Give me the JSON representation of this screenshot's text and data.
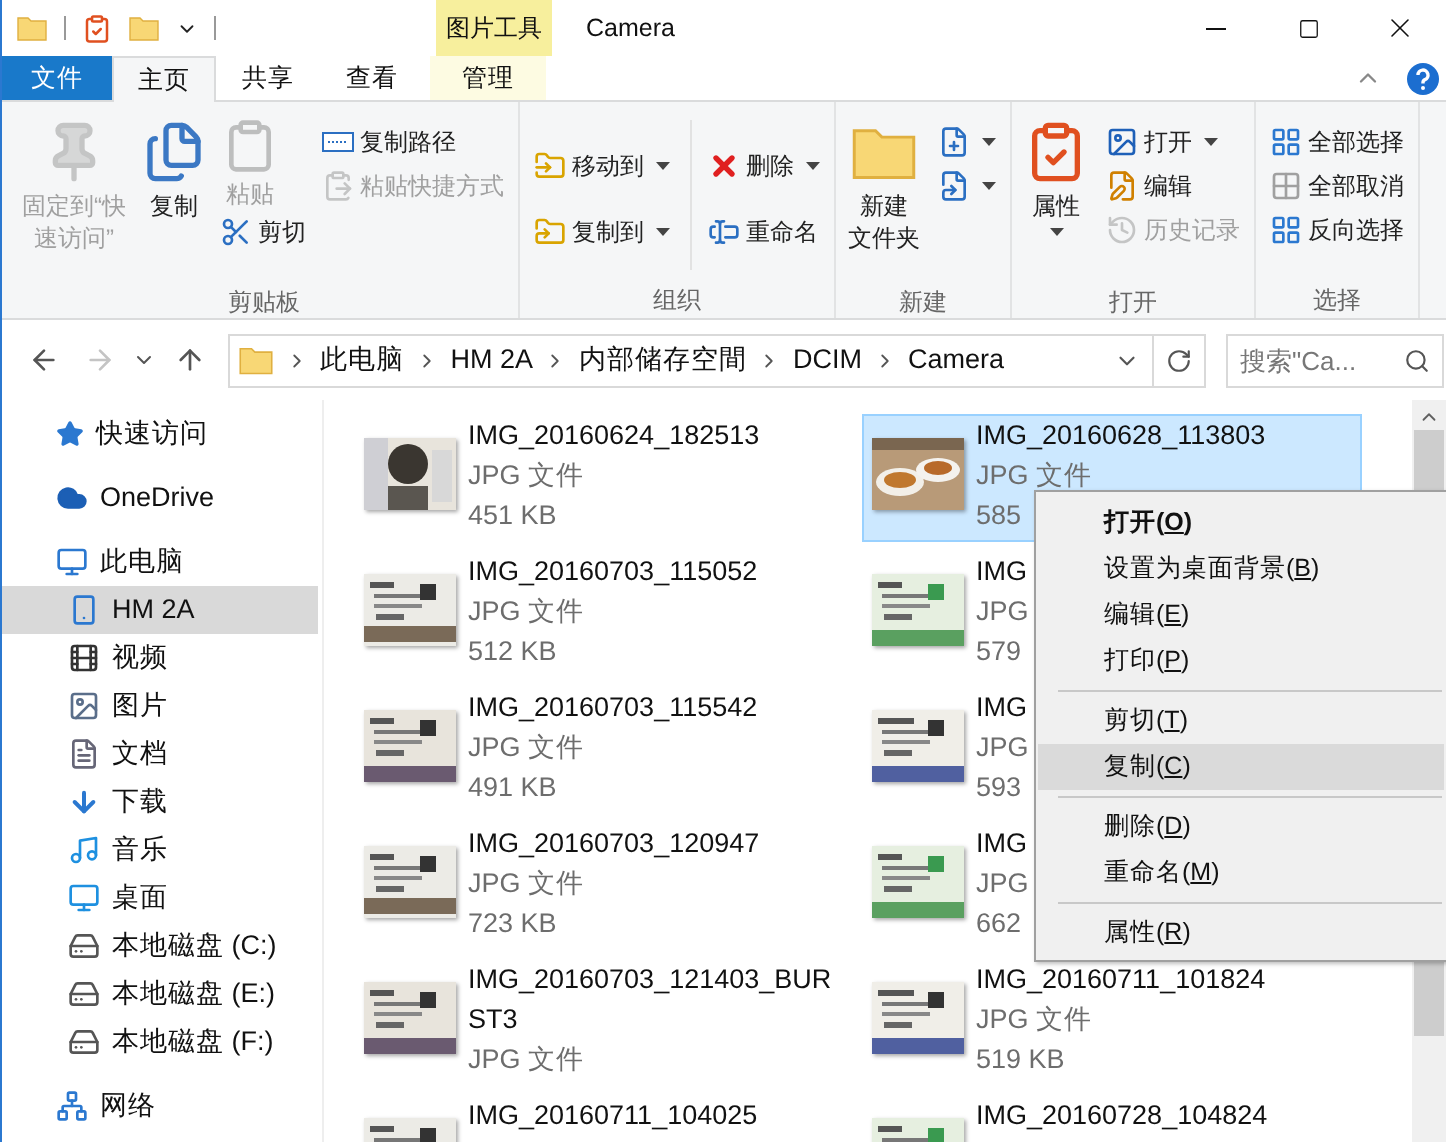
{
  "window": {
    "title": "Camera",
    "context_header": "图片工具"
  },
  "tabs": [
    {
      "label": "文件",
      "kind": "file",
      "selected": false
    },
    {
      "label": "主页",
      "kind": "tab",
      "selected": true
    },
    {
      "label": "共享",
      "kind": "tab",
      "selected": false
    },
    {
      "label": "查看",
      "kind": "tab",
      "selected": false
    },
    {
      "label": "管理",
      "kind": "context",
      "selected": false
    }
  ],
  "ribbon": {
    "groups": [
      {
        "label": "剪贴板",
        "columns": [
          {
            "kind": "large",
            "items": [
              {
                "lines": [
                  "固定到“快",
                  "速访问”"
                ],
                "disabled": true,
                "dropdown": false
              }
            ]
          },
          {
            "kind": "large",
            "items": [
              {
                "lines": [
                  "复制"
                ],
                "disabled": false,
                "dropdown": false
              }
            ]
          },
          {
            "kind": "medium",
            "items": [
              {
                "label": "粘贴",
                "disabled": true,
                "dropdown": false
              },
              {
                "label": "剪切",
                "disabled": false,
                "dropdown": false
              }
            ]
          },
          {
            "kind": "small",
            "items": [
              {
                "label": "复制路径",
                "disabled": false,
                "dropdown": false
              },
              {
                "label": "粘贴快捷方式",
                "disabled": true,
                "dropdown": false
              }
            ]
          }
        ]
      },
      {
        "label": "组织",
        "columns": [
          {
            "kind": "small",
            "items": [
              {
                "label": "移动到",
                "disabled": false,
                "dropdown": true
              },
              {
                "label": "复制到",
                "disabled": false,
                "dropdown": true
              }
            ]
          },
          {
            "kind": "small",
            "items": [
              {
                "label": "删除",
                "disabled": false,
                "dropdown": true
              },
              {
                "label": "重命名",
                "disabled": false,
                "dropdown": false
              }
            ]
          }
        ]
      },
      {
        "label": "新建",
        "columns": [
          {
            "kind": "large",
            "items": [
              {
                "lines": [
                  "新建",
                  "文件夹"
                ],
                "disabled": false,
                "dropdown": false
              }
            ]
          },
          {
            "kind": "small",
            "items": [
              {
                "disabled": false,
                "dropdown": true
              },
              {
                "disabled": false,
                "dropdown": true
              }
            ]
          }
        ]
      },
      {
        "label": "打开",
        "columns": [
          {
            "kind": "large",
            "items": [
              {
                "lines": [
                  "属性"
                ],
                "disabled": false,
                "dropdown": true
              }
            ]
          },
          {
            "kind": "small",
            "items": [
              {
                "label": "打开",
                "disabled": false,
                "dropdown": true
              },
              {
                "label": "编辑",
                "disabled": false,
                "dropdown": false
              },
              {
                "label": "历史记录",
                "disabled": true,
                "dropdown": false
              }
            ]
          }
        ]
      },
      {
        "label": "选择",
        "columns": [
          {
            "kind": "small",
            "items": [
              {
                "label": "全部选择",
                "disabled": false,
                "dropdown": false
              },
              {
                "label": "全部取消",
                "disabled": false,
                "dropdown": false
              },
              {
                "label": "反向选择",
                "disabled": false,
                "dropdown": false
              }
            ]
          }
        ]
      }
    ]
  },
  "address": {
    "buttons": [
      {
        "kind": "back",
        "disabled": false
      },
      {
        "kind": "forward",
        "disabled": true
      },
      {
        "kind": "recent",
        "disabled": false
      },
      {
        "kind": "up",
        "disabled": false
      }
    ],
    "path": [
      "此电脑",
      "HM 2A",
      "内部储存空間",
      "DCIM",
      "Camera"
    ],
    "search": {
      "placeholder": "搜索\"Ca..."
    }
  },
  "nav": [
    {
      "label": "快速访问",
      "kind": "quick",
      "selected": false
    },
    {
      "label": "OneDrive",
      "kind": "cloud",
      "selected": false
    },
    {
      "label": "此电脑",
      "kind": "pc",
      "selected": false,
      "children": [
        {
          "label": "HM 2A",
          "kind": "phone",
          "selected": true
        },
        {
          "label": "视频",
          "kind": "video",
          "selected": false
        },
        {
          "label": "图片",
          "kind": "pictures",
          "selected": false
        },
        {
          "label": "文档",
          "kind": "documents",
          "selected": false
        },
        {
          "label": "下载",
          "kind": "downloads",
          "selected": false
        },
        {
          "label": "音乐",
          "kind": "music",
          "selected": false
        },
        {
          "label": "桌面",
          "kind": "desktop",
          "selected": false
        },
        {
          "label": "本地磁盘 (C:)",
          "kind": "system-drive",
          "selected": false
        },
        {
          "label": "本地磁盘 (E:)",
          "kind": "drive",
          "selected": false
        },
        {
          "label": "本地磁盘 (F:)",
          "kind": "drive",
          "selected": false
        }
      ]
    },
    {
      "label": "网络",
      "kind": "network",
      "selected": false
    }
  ],
  "files": [
    {
      "name": "IMG_20160624_182513",
      "type": "JPG 文件",
      "size": "451 KB",
      "selected": false
    },
    {
      "name": "IMG_20160628_113803",
      "type": "JPG 文件",
      "size": "585",
      "selected": true
    },
    {
      "name": "IMG_20160703_115052",
      "type": "JPG 文件",
      "size": "512 KB",
      "selected": false
    },
    {
      "name": "IMG",
      "type": "JPG",
      "size": "579",
      "selected": false
    },
    {
      "name": "IMG_20160703_115542",
      "type": "JPG 文件",
      "size": "491 KB",
      "selected": false
    },
    {
      "name": "IMG",
      "type": "JPG",
      "size": "593",
      "selected": false
    },
    {
      "name": "IMG_20160703_120947",
      "type": "JPG 文件",
      "size": "723 KB",
      "selected": false
    },
    {
      "name": "IMG",
      "type": "JPG",
      "size": "662",
      "selected": false
    },
    {
      "name": "IMG_20160703_121403_BURST3",
      "type": "JPG 文件",
      "selected": false
    },
    {
      "name": "IMG_20160711_101824",
      "type": "JPG 文件",
      "size": "519 KB",
      "selected": false
    },
    {
      "name": "IMG_20160711_104025",
      "selected": false
    },
    {
      "name": "IMG_20160728_104824",
      "selected": false
    }
  ],
  "context_menu": [
    [
      {
        "label": "打开(O)",
        "default": true,
        "selected": false
      },
      {
        "label": "设置为桌面背景(B)",
        "default": false,
        "selected": false
      },
      {
        "label": "编辑(E)",
        "default": false,
        "selected": false
      },
      {
        "label": "打印(P)",
        "default": false,
        "selected": false
      }
    ],
    [
      {
        "label": "剪切(T)",
        "default": false,
        "selected": false
      },
      {
        "label": "复制(C)",
        "default": false,
        "selected": true
      }
    ],
    [
      {
        "label": "删除(D)",
        "default": false,
        "selected": false
      },
      {
        "label": "重命名(M)",
        "default": false,
        "selected": false
      }
    ],
    [
      {
        "label": "属性(R)",
        "default": false,
        "selected": false
      }
    ]
  ]
}
